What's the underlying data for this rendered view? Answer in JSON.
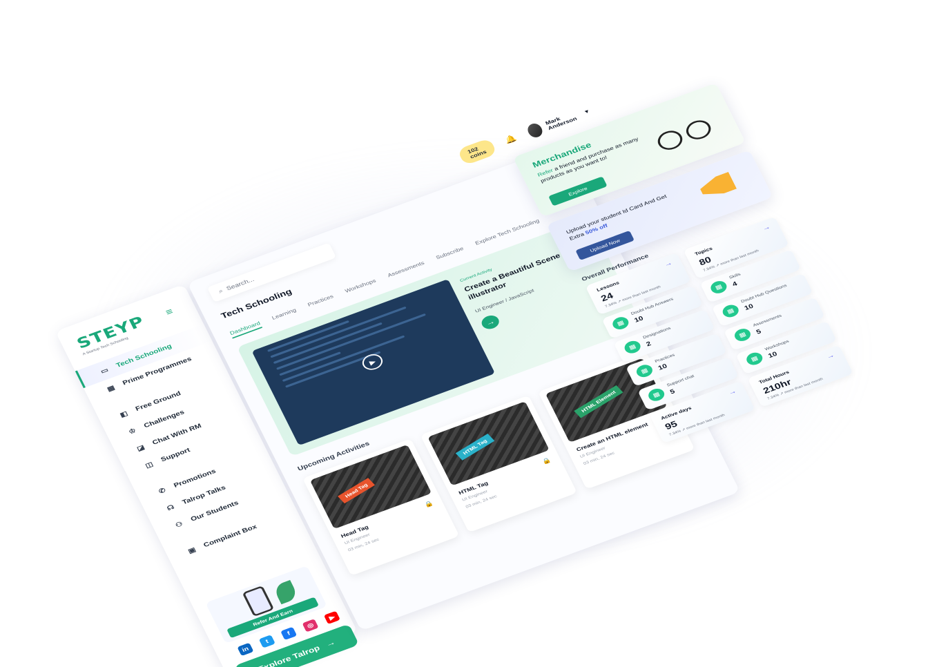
{
  "sidebar": {
    "logo": "STEYP",
    "logo_sub": "A Startup Tech Schooling",
    "menu_icon": "hamburger-icon",
    "items": [
      {
        "label": "Tech Schooling",
        "icon": "tv-icon"
      },
      {
        "label": "Prime Programmes",
        "icon": "calendar-icon"
      },
      {
        "label": "Free Ground",
        "icon": "cup-icon"
      },
      {
        "label": "Challenges",
        "icon": "trophy-icon"
      },
      {
        "label": "Chat With RM",
        "icon": "chat-icon"
      },
      {
        "label": "Support",
        "icon": "headset-icon"
      },
      {
        "label": "Promotions",
        "icon": "phone-icon"
      },
      {
        "label": "Talrop Talks",
        "icon": "talk-icon"
      },
      {
        "label": "Our Students",
        "icon": "user-icon"
      },
      {
        "label": "Complaint Box",
        "icon": "box-icon"
      }
    ],
    "refer_label": "Refer And Earn",
    "socials": [
      "in",
      "t",
      "f",
      "ig",
      "yt"
    ],
    "explore_label": "Explore Talrop"
  },
  "header": {
    "search_placeholder": "Search...",
    "coins": "102 coins",
    "user_name": "Mark Anderson"
  },
  "main": {
    "title": "Tech Schooling",
    "tabs": [
      "Dashboard",
      "Learning",
      "Practices",
      "Workshops",
      "Assessments",
      "Subscribe",
      "Explore Tech Schooling"
    ],
    "hero": {
      "eyebrow": "Current Activity",
      "title": "Create a Beautiful Scene in illustrator",
      "subtitle": "UI Engineer / JavaScript"
    },
    "upcoming_title": "Upcoming Activities",
    "activities": [
      {
        "tag": "Head Tag",
        "title": "Head Tag",
        "role": "UI Engineer",
        "time": "03 min, 24 sec",
        "tag_color": "#e8542d"
      },
      {
        "tag": "HTML Tag",
        "title": "HTML Tag",
        "role": "UI Engineer",
        "time": "03 min, 24 sec",
        "tag_color": "#2ab1c9"
      },
      {
        "tag": "HTML Element",
        "title": "Create an HTML element",
        "role": "UI Engineer",
        "time": "03 min, 24 sec",
        "tag_color": "#2aa26a"
      }
    ]
  },
  "merch": {
    "title": "Merchandise",
    "text_highlight": "Refer",
    "text": "a friend and purchase as many products as you want to!",
    "button": "Explore"
  },
  "idcard": {
    "text": "Upload your student Id Card And Get Extra",
    "offer": "50% off",
    "button": "Upload Now"
  },
  "performance": {
    "title": "Overall Performance",
    "big": [
      {
        "label": "Lessons",
        "value": "24",
        "trend": "7.34% ↗ more than last month"
      },
      {
        "label": "Topics",
        "value": "80",
        "trend": "7.34% ↗ more than last month"
      },
      {
        "label": "Active days",
        "value": "95",
        "trend": "7.34% ↗ more than last month"
      },
      {
        "label": "Total Hours",
        "value": "210hr",
        "trend": "7.34% ↗ more than last month"
      }
    ],
    "small": [
      {
        "label": "Skills",
        "value": "4"
      },
      {
        "label": "Doubt Hub Answers",
        "value": "10"
      },
      {
        "label": "Doubt Hub Questions",
        "value": "10"
      },
      {
        "label": "Designations",
        "value": "2"
      },
      {
        "label": "Assessments",
        "value": "5"
      },
      {
        "label": "Practices",
        "value": "10"
      },
      {
        "label": "Workshops",
        "value": "10"
      },
      {
        "label": "Support chat",
        "value": "5"
      }
    ]
  }
}
